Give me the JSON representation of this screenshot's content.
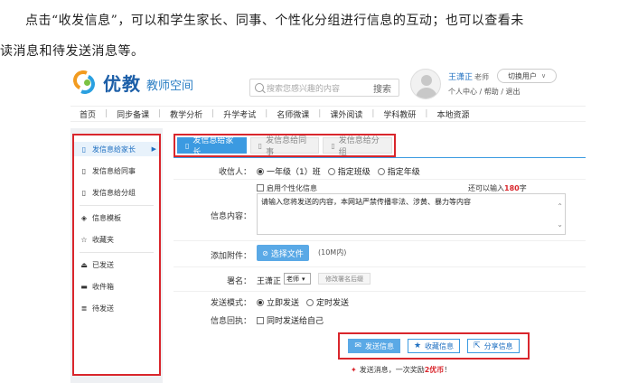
{
  "intro": {
    "line1": "点击“收发信息”，可以和学生家长、同事、个性化分组进行信息的互动；也可以查看未",
    "line2": "读消息和待发送消息等。"
  },
  "header": {
    "brand": "优教",
    "brand_sub": "教师空间",
    "search_placeholder": "搜索您感兴趣的内容",
    "search_button": "搜索",
    "user_name": "王潇正",
    "user_role": "老师",
    "user_links": "个人中心 / 帮助 / 退出",
    "switch_label": "切换用户"
  },
  "nav": {
    "items": [
      "首页",
      "同步备课",
      "教学分析",
      "升学考试",
      "名师微课",
      "课外阅读",
      "学科教研",
      "本地资源"
    ]
  },
  "sidebar": {
    "items": [
      {
        "label": "发信息给家长",
        "icon": "phone-icon"
      },
      {
        "label": "发信息给同事",
        "icon": "phone-icon"
      },
      {
        "label": "发信息给分组",
        "icon": "phone-icon"
      },
      {
        "label": "信息模板",
        "icon": "layers-icon"
      },
      {
        "label": "收藏夹",
        "icon": "star-icon"
      },
      {
        "label": "已发送",
        "icon": "tray-icon"
      },
      {
        "label": "收件箱",
        "icon": "inbox-icon"
      },
      {
        "label": "待发送",
        "icon": "list-icon"
      }
    ]
  },
  "tabs": [
    "发信息给家长",
    "发信息给同事",
    "发信息给分组"
  ],
  "form": {
    "recipient_label": "收信人：",
    "recipient_options": [
      "一年级（1）班",
      "指定班级",
      "指定年级"
    ],
    "personal_info": "启用个性化信息",
    "limit_prefix": "还可以输入",
    "limit_count": "180",
    "limit_suffix": "字",
    "content_label": "信息内容：",
    "content_text": "请输入您将发送的内容，本网站严禁传播非法、涉黄、暴力等内容",
    "attach_label": "添加附件：",
    "attach_button": "选择文件",
    "attach_hint": "(10M内)",
    "sign_label": "署名：",
    "sign_name": "王潇正",
    "sign_select": "老师",
    "sign_modify": "修改署名后缀",
    "mode_label": "发送模式：",
    "mode_options": [
      "立即发送",
      "定时发送"
    ],
    "receipt_label": "信息回执：",
    "receipt_option": "同时发送给自己"
  },
  "actions": {
    "send": "发送信息",
    "favorite": "收藏信息",
    "share": "分享信息"
  },
  "reward": {
    "prefix": "发送消息，一次奖励",
    "amount": "2优币",
    "suffix": "！"
  },
  "colors": {
    "accent": "#3b9ae1",
    "highlight_box": "#d9262c",
    "brand_blue": "#1d5fa8"
  }
}
